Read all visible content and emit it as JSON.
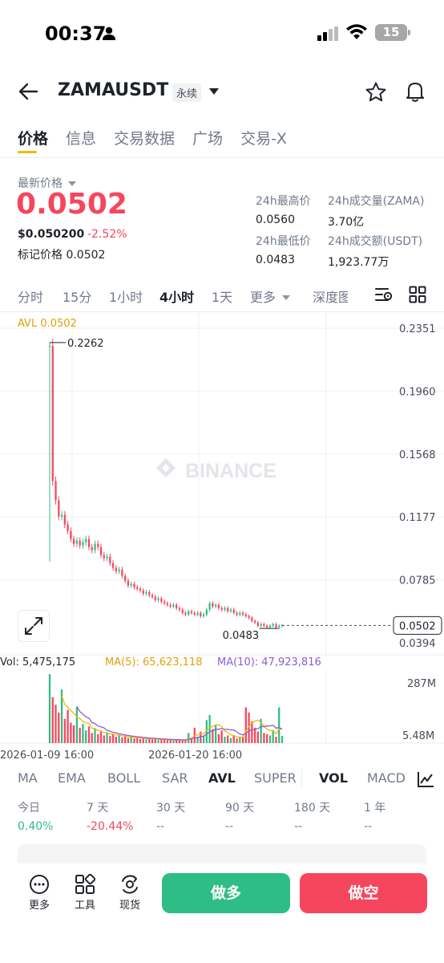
{
  "status": {
    "time": "00:37",
    "battery": "15"
  },
  "header": {
    "symbol": "ZAMAUSDT",
    "contract_type": "永续"
  },
  "tabs": [
    {
      "label": "价格",
      "active": true
    },
    {
      "label": "信息"
    },
    {
      "label": "交易数据"
    },
    {
      "label": "广场"
    },
    {
      "label": "交易-X"
    }
  ],
  "price": {
    "label": "最新价格",
    "last": "0.0502",
    "usd": "$0.050200",
    "change": "-2.52%",
    "mark_label": "标记价格",
    "mark": "0.0502"
  },
  "stats": {
    "high_label": "24h最高价",
    "high": "0.0560",
    "vol_label": "24h成交量(ZAMA)",
    "vol": "3.70亿",
    "low_label": "24h最低价",
    "low": "0.0483",
    "turnover_label": "24h成交额(USDT)",
    "turnover": "1,923.77万"
  },
  "intervals": [
    "分时",
    "15分",
    "1小时",
    "4小时",
    "1天",
    "更多",
    "深度图"
  ],
  "active_interval": "4小时",
  "chart_data": {
    "type": "candlestick",
    "avl_label": "AVL 0.0502",
    "watermark": "BINANCE",
    "price_axis": [
      "0.2351",
      "0.1960",
      "0.1568",
      "0.1177",
      "0.0785",
      "0.0394"
    ],
    "ylim": [
      0.0394,
      0.2351
    ],
    "high_marker": "0.2262",
    "low_marker": "0.0483",
    "last_price_tag": "0.0502",
    "close_series": [
      0.224,
      0.14,
      0.128,
      0.118,
      0.119,
      0.113,
      0.109,
      0.104,
      0.101,
      0.103,
      0.1,
      0.102,
      0.104,
      0.099,
      0.097,
      0.101,
      0.099,
      0.094,
      0.092,
      0.093,
      0.089,
      0.086,
      0.084,
      0.085,
      0.081,
      0.078,
      0.075,
      0.076,
      0.074,
      0.073,
      0.072,
      0.07,
      0.071,
      0.069,
      0.068,
      0.066,
      0.067,
      0.065,
      0.064,
      0.063,
      0.062,
      0.063,
      0.061,
      0.06,
      0.058,
      0.057,
      0.059,
      0.058,
      0.057,
      0.058,
      0.056,
      0.057,
      0.06,
      0.064,
      0.062,
      0.063,
      0.061,
      0.06,
      0.061,
      0.059,
      0.06,
      0.058,
      0.057,
      0.058,
      0.057,
      0.056,
      0.055,
      0.053,
      0.052,
      0.05,
      0.051,
      0.05,
      0.049,
      0.05,
      0.051,
      0.049,
      0.05,
      0.0502
    ],
    "volume_label": "Vol: 5,475,175",
    "ma5_label": "MA(5): 65,623,118",
    "ma10_label": "MA(10): 47,923,816",
    "volume_axis": [
      "287M",
      "5.48M"
    ],
    "volume_series": [
      270,
      180,
      150,
      120,
      210,
      95,
      130,
      80,
      70,
      140,
      60,
      75,
      50,
      65,
      40,
      55,
      35,
      45,
      30,
      40,
      28,
      35,
      25,
      30,
      22,
      26,
      20,
      24,
      18,
      22,
      16,
      20,
      15,
      18,
      14,
      16,
      12,
      14,
      15,
      11,
      13,
      10,
      12,
      14,
      11,
      13,
      40,
      20,
      60,
      25,
      45,
      30,
      90,
      110,
      55,
      70,
      35,
      50,
      25,
      30,
      20,
      28,
      18,
      22,
      26,
      140,
      120,
      85,
      60,
      45,
      95,
      40,
      35,
      30,
      50,
      25,
      140,
      28
    ],
    "x_labels": [
      "2026-01-09 16:00",
      "2026-01-20 16:00"
    ],
    "colors": {
      "up": "#2ebd85",
      "down": "#f6465d",
      "ma5": "#f0b90b",
      "ma10": "#8b5cd6"
    }
  },
  "indicators": [
    "MA",
    "EMA",
    "BOLL",
    "SAR",
    "AVL",
    "SUPER",
    "VOL",
    "MACD"
  ],
  "active_indicators": [
    "AVL",
    "VOL"
  ],
  "performance": [
    {
      "label": "今日",
      "value": "0.40%",
      "color": "#2ebd85"
    },
    {
      "label": "7 天",
      "value": "-20.44%",
      "color": "#f6465d"
    },
    {
      "label": "30 天",
      "value": "--"
    },
    {
      "label": "90 天",
      "value": "--"
    },
    {
      "label": "180 天",
      "value": "--"
    },
    {
      "label": "1 年",
      "value": "--"
    }
  ],
  "bottom": {
    "more": "更多",
    "tools": "工具",
    "spot": "现货",
    "long": "做多",
    "short": "做空"
  }
}
